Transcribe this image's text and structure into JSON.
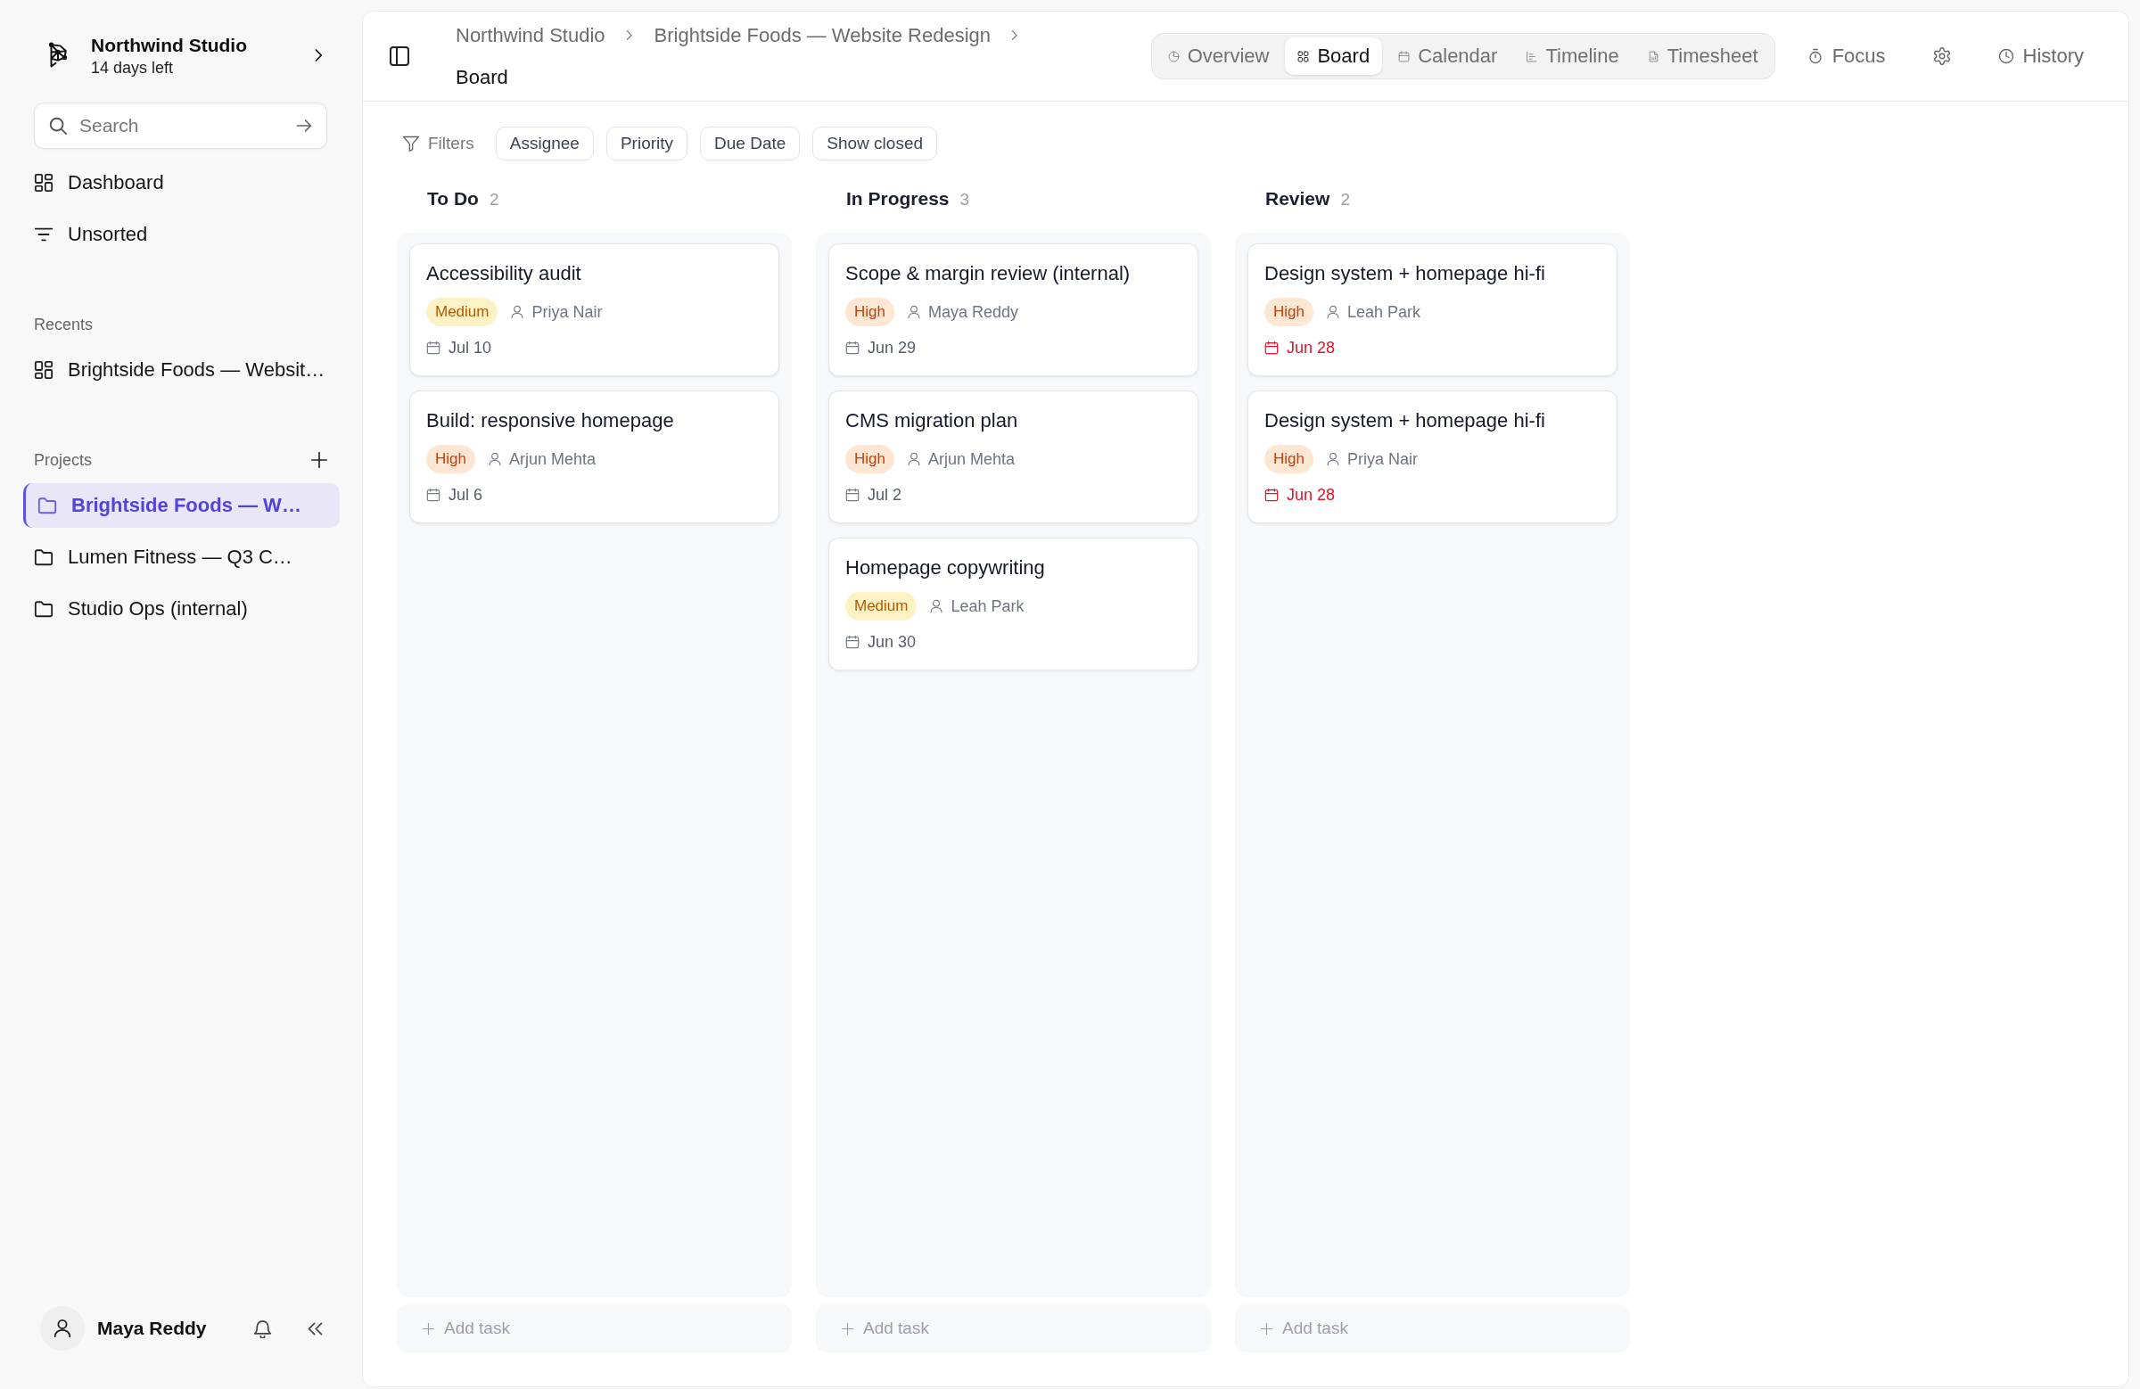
{
  "sidebar": {
    "workspace": {
      "name": "Northwind Studio",
      "trial": "14 days left"
    },
    "search": {
      "placeholder": "Search"
    },
    "nav": [
      {
        "label": "Dashboard"
      },
      {
        "label": "Unsorted"
      }
    ],
    "recents": {
      "title": "Recents",
      "items": [
        {
          "label": "Brightside Foods — Websit…"
        }
      ]
    },
    "projects": {
      "title": "Projects",
      "items": [
        {
          "label": "Brightside Foods — W…",
          "selected": true
        },
        {
          "label": "Lumen Fitness — Q3 C…",
          "selected": false
        },
        {
          "label": "Studio Ops (internal)",
          "selected": false
        }
      ]
    },
    "user": {
      "name": "Maya Reddy"
    }
  },
  "header": {
    "breadcrumb": [
      {
        "label": "Northwind Studio"
      },
      {
        "label": "Brightside Foods — Website Redesign"
      }
    ],
    "page_title": "Board",
    "view_tabs": [
      {
        "label": "Overview",
        "selected": false
      },
      {
        "label": "Board",
        "selected": true
      },
      {
        "label": "Calendar",
        "selected": false
      },
      {
        "label": "Timeline",
        "selected": false
      },
      {
        "label": "Timesheet",
        "selected": false
      }
    ],
    "actions": [
      {
        "label": "Focus"
      },
      {
        "label": "History"
      }
    ]
  },
  "filters": {
    "label": "Filters",
    "chips": [
      {
        "label": "Assignee"
      },
      {
        "label": "Priority"
      },
      {
        "label": "Due Date"
      },
      {
        "label": "Show closed"
      }
    ]
  },
  "columns": [
    {
      "title": "To Do",
      "count": "2",
      "add_label": "Add task",
      "cards": [
        {
          "title": "Accessibility audit",
          "priority": {
            "label": "Medium",
            "kind": "medium"
          },
          "assignee": "Priya Nair",
          "due": "Jul 10",
          "overdue": false
        },
        {
          "title": "Build: responsive homepage",
          "priority": {
            "label": "High",
            "kind": "high"
          },
          "assignee": "Arjun Mehta",
          "due": "Jul 6",
          "overdue": false
        }
      ]
    },
    {
      "title": "In Progress",
      "count": "3",
      "add_label": "Add task",
      "cards": [
        {
          "title": "Scope & margin review (internal)",
          "priority": {
            "label": "High",
            "kind": "high"
          },
          "assignee": "Maya Reddy",
          "due": "Jun 29",
          "overdue": false
        },
        {
          "title": "CMS migration plan",
          "priority": {
            "label": "High",
            "kind": "high"
          },
          "assignee": "Arjun Mehta",
          "due": "Jul 2",
          "overdue": false
        },
        {
          "title": "Homepage copywriting",
          "priority": {
            "label": "Medium",
            "kind": "medium"
          },
          "assignee": "Leah Park",
          "due": "Jun 30",
          "overdue": false
        }
      ]
    },
    {
      "title": "Review",
      "count": "2",
      "add_label": "Add task",
      "cards": [
        {
          "title": "Design system + homepage hi-fi",
          "priority": {
            "label": "High",
            "kind": "high"
          },
          "assignee": "Leah Park",
          "due": "Jun 28",
          "overdue": true
        },
        {
          "title": "Design system + homepage hi-fi",
          "priority": {
            "label": "High",
            "kind": "high"
          },
          "assignee": "Priya Nair",
          "due": "Jun 28",
          "overdue": true
        }
      ]
    }
  ]
}
